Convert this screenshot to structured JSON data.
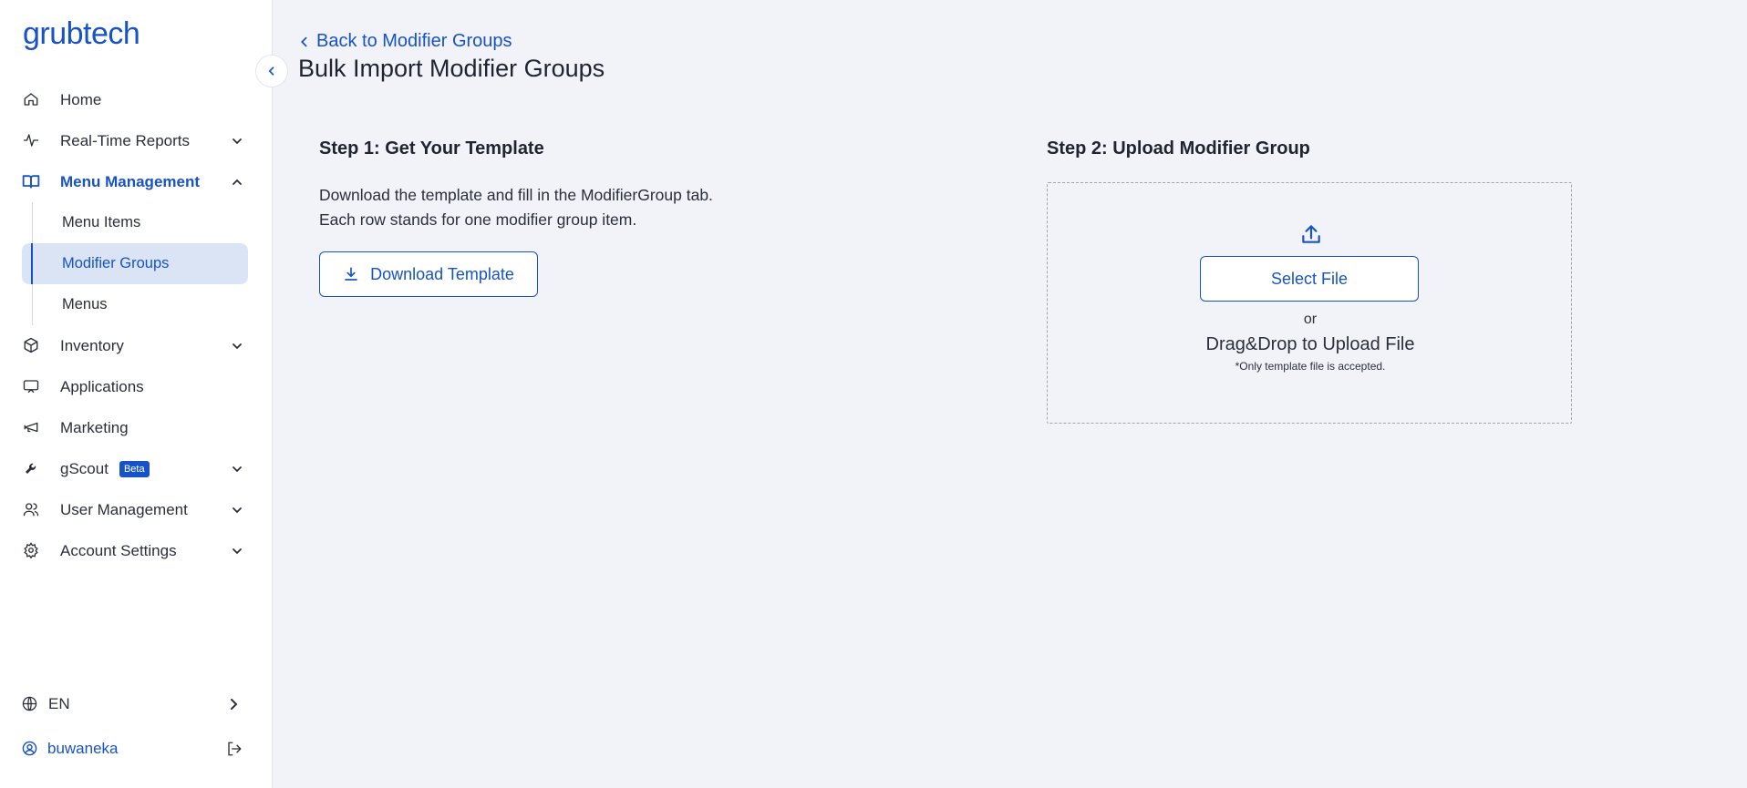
{
  "brand": {
    "logo_text": "grubtech",
    "accent": "#1753c6"
  },
  "sidebar": {
    "items": [
      {
        "label": "Home",
        "icon": "home-icon"
      },
      {
        "label": "Real-Time Reports",
        "icon": "activity-icon",
        "expandable": true
      },
      {
        "label": "Menu Management",
        "icon": "book-icon",
        "expandable": true,
        "expanded": true,
        "active": true,
        "children": [
          {
            "label": "Menu Items"
          },
          {
            "label": "Modifier Groups",
            "selected": true
          },
          {
            "label": "Menus"
          }
        ]
      },
      {
        "label": "Inventory",
        "icon": "box-icon",
        "expandable": true
      },
      {
        "label": "Applications",
        "icon": "monitor-icon"
      },
      {
        "label": "Marketing",
        "icon": "megaphone-icon"
      },
      {
        "label": "gScout",
        "icon": "wrench-icon",
        "expandable": true,
        "badge": "Beta"
      },
      {
        "label": "User Management",
        "icon": "users-icon",
        "expandable": true
      },
      {
        "label": "Account Settings",
        "icon": "gear-icon",
        "expandable": true
      }
    ],
    "language": "EN",
    "username": "buwaneka"
  },
  "page": {
    "back_link": "Back to Modifier Groups",
    "title": "Bulk Import Modifier Groups"
  },
  "step1": {
    "title": "Step 1: Get Your Template",
    "desc_line1": "Download the template and fill in the ModifierGroup tab.",
    "desc_line2": "Each row stands for one modifier group item.",
    "button": "Download Template"
  },
  "step2": {
    "title": "Step 2: Upload Modifier Group",
    "button": "Select File",
    "or": "or",
    "drag_text": "Drag&Drop to Upload File",
    "note": "*Only template file is accepted."
  }
}
